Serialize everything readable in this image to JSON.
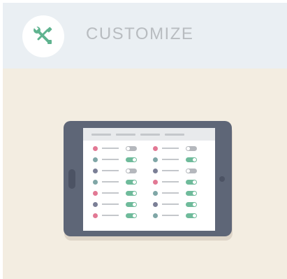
{
  "header": {
    "title": "CUSTOMIZE",
    "icon": "tools-icon"
  },
  "colors": {
    "header_bg": "#eaeff3",
    "page_bg": "#f3ede1",
    "icon_green": "#5fb38f",
    "tablet_frame": "#5e6677",
    "tablet_frame_dark": "#4c5364",
    "screen_bar": "#e8eaec",
    "toggle_on": "#6fbb9b",
    "toggle_off": "#b5b8bd",
    "dot_pink": "#e27894",
    "dot_teal": "#7fa6a6",
    "dot_slate": "#7b7f96"
  },
  "tablet": {
    "tabs": 4,
    "left_column": [
      {
        "dot": "pink",
        "toggle": "off"
      },
      {
        "dot": "teal",
        "toggle": "on"
      },
      {
        "dot": "slate",
        "toggle": "off"
      },
      {
        "dot": "teal",
        "toggle": "on"
      },
      {
        "dot": "pink",
        "toggle": "on"
      },
      {
        "dot": "slate",
        "toggle": "on"
      },
      {
        "dot": "pink",
        "toggle": "on"
      }
    ],
    "right_column": [
      {
        "dot": "pink",
        "toggle": "off"
      },
      {
        "dot": "teal",
        "toggle": "on"
      },
      {
        "dot": "slate",
        "toggle": "off"
      },
      {
        "dot": "pink",
        "toggle": "on"
      },
      {
        "dot": "teal",
        "toggle": "on"
      },
      {
        "dot": "slate",
        "toggle": "on"
      },
      {
        "dot": "teal",
        "toggle": "on"
      }
    ]
  }
}
